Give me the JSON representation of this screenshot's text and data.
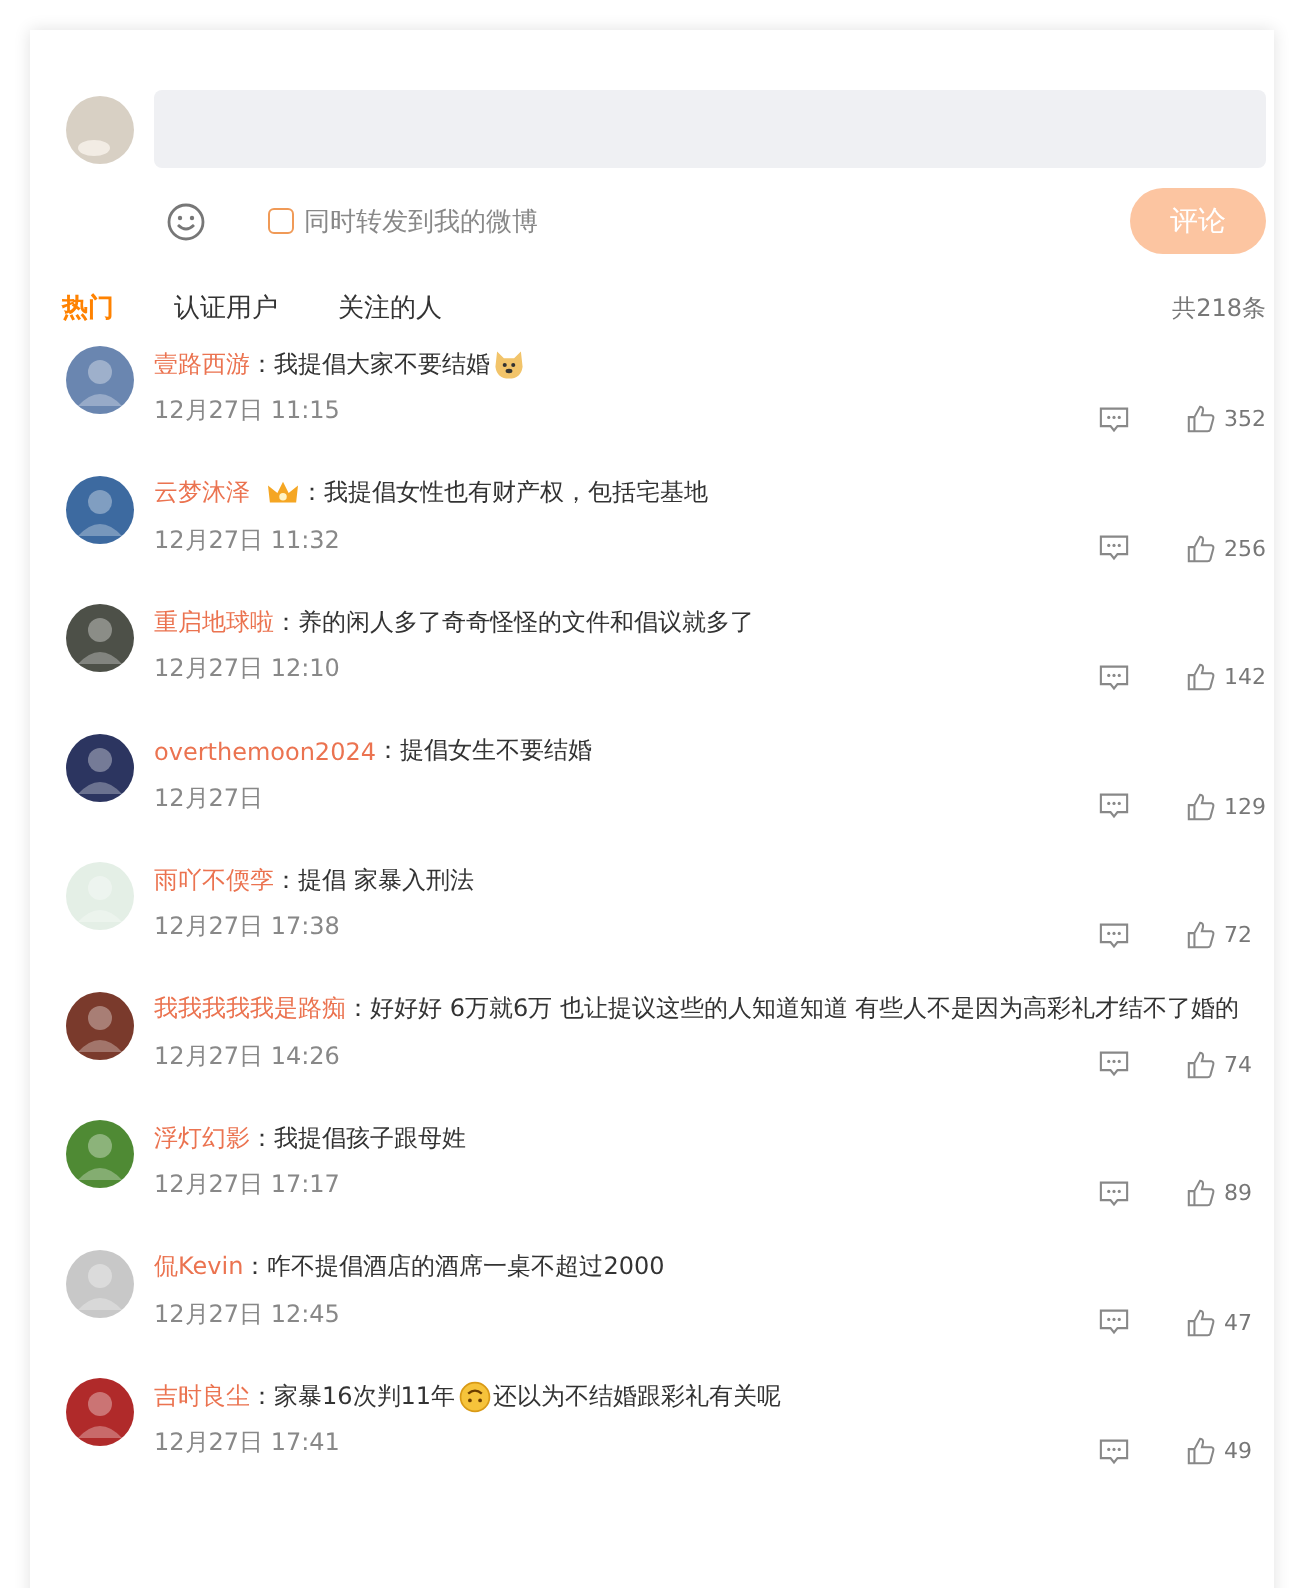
{
  "composer": {
    "repost": {
      "label": "同时转发到我的微博",
      "checked": false
    },
    "submit": {
      "label": "评论",
      "disabled": true
    }
  },
  "tabs": [
    {
      "label": "热门",
      "selected": true
    },
    {
      "label": "认证用户",
      "selected": false
    },
    {
      "label": "关注的人",
      "selected": false
    }
  ],
  "total": "共218条",
  "comments": [
    {
      "name": "壹路西游",
      "content": [
        {
          "kind": "colon",
          "text": "："
        },
        {
          "kind": "text",
          "text": "我提倡大家不要结婚"
        },
        {
          "kind": "dog_emoji"
        }
      ],
      "time": "12月27日 11:15",
      "likes": "352"
    },
    {
      "name": "云梦沐泽",
      "content": [
        {
          "kind": "badge"
        },
        {
          "kind": "colon",
          "text": "："
        },
        {
          "kind": "text",
          "text": "我提倡女性也有财产权，包括宅基地"
        }
      ],
      "time": "12月27日 11:32",
      "likes": "256"
    },
    {
      "name": "重启地球啦",
      "content": [
        {
          "kind": "colon",
          "text": "："
        },
        {
          "kind": "text",
          "text": "养的闲人多了奇奇怪怪的文件和倡议就多了"
        }
      ],
      "time": "12月27日 12:10",
      "likes": "142"
    },
    {
      "name": "overthemoon2024",
      "content": [
        {
          "kind": "colon",
          "text": "："
        },
        {
          "kind": "text",
          "text": "提倡女生不要结婚"
        }
      ],
      "time": "12月27日",
      "likes": "129"
    },
    {
      "name": "雨吖不偄孪",
      "content": [
        {
          "kind": "colon",
          "text": "："
        },
        {
          "kind": "text",
          "text": "提倡 家暴入刑法"
        }
      ],
      "time": "12月27日 17:38",
      "likes": "72"
    },
    {
      "name": "我我我我我是路痴",
      "content": [
        {
          "kind": "colon",
          "text": "："
        },
        {
          "kind": "text",
          "text": "好好好 6万就6万 也让提议这些的人知道知道 有些人不是因为高彩礼才结不了婚的"
        }
      ],
      "time": "12月27日 14:26",
      "likes": "74"
    },
    {
      "name": "浮灯幻影",
      "content": [
        {
          "kind": "colon",
          "text": "："
        },
        {
          "kind": "text",
          "text": "我提倡孩子跟母姓"
        }
      ],
      "time": "12月27日 17:17",
      "likes": "89"
    },
    {
      "name": "侃Kevin",
      "content": [
        {
          "kind": "colon",
          "text": "："
        },
        {
          "kind": "text",
          "text": "咋不提倡酒店的酒席一桌不超过2000"
        }
      ],
      "time": "12月27日 12:45",
      "likes": "47"
    },
    {
      "name": "吉时良尘",
      "content": [
        {
          "kind": "colon",
          "text": "："
        },
        {
          "kind": "text",
          "text": "家暴16次判11年"
        },
        {
          "kind": "upside_emoji"
        },
        {
          "kind": "text",
          "text": "还以为不结婚跟彩礼有关呢"
        }
      ],
      "time": "12月27日 17:41",
      "likes": "49"
    }
  ]
}
